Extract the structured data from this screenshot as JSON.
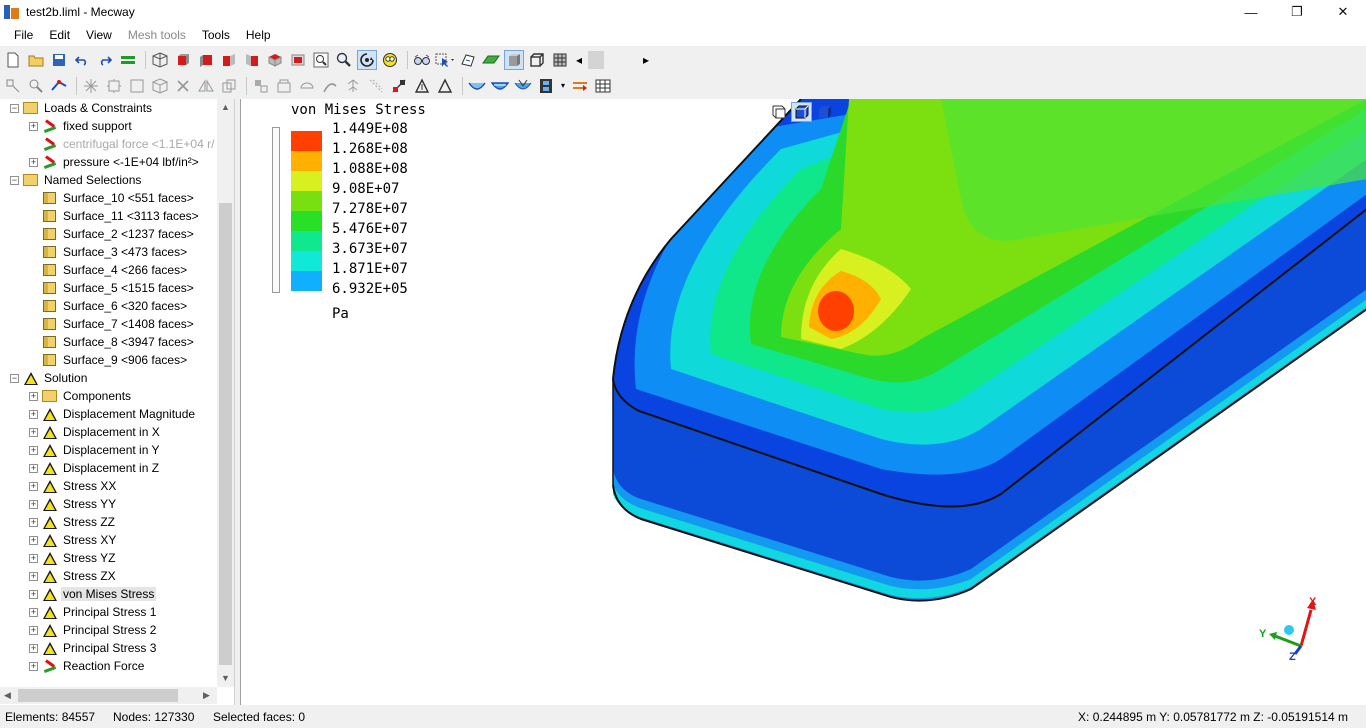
{
  "window": {
    "title": "test2b.liml - Mecway",
    "controls": {
      "minimize": "—",
      "maximize": "❐",
      "close": "✕"
    }
  },
  "menu": {
    "items": [
      "File",
      "Edit",
      "View",
      "Mesh tools",
      "Tools",
      "Help"
    ],
    "disabled": [
      "Mesh tools"
    ]
  },
  "toolbar1": {
    "icons": [
      "new-file-icon",
      "open-folder-icon",
      "save-icon",
      "undo-icon",
      "redo-icon",
      "equal-icon",
      "wireframe-cube-icon",
      "front-view-icon",
      "back-view-icon",
      "left-view-icon",
      "right-view-icon",
      "top-view-icon",
      "bottom-view-icon",
      "zoom-box-icon",
      "zoom-icon",
      "rotate-icon",
      "pan-icon",
      "glasses-icon",
      "cursor-icon",
      "select-box-icon",
      "surface-icon",
      "shaded-icon",
      "edges-icon",
      "hidden-lines-icon"
    ],
    "scroll_left": "◂",
    "scroll_right": "▸"
  },
  "toolbar2": {
    "icons": [
      "select-nodes-icon",
      "select-elements-icon",
      "select-faces-icon",
      "select-all-icon",
      "node-icon",
      "element-icon",
      "cube-outline-icon",
      "delete-icon",
      "mirror-icon",
      "copy-icon",
      "move-icon",
      "scale-icon",
      "refine-icon",
      "extrude-icon",
      "revolve-icon",
      "sweep-icon",
      "merge-icon",
      "split-icon",
      "tetra-icon",
      "triangle-icon",
      "bowl-icon",
      "bowl-fill-icon",
      "animate-icon",
      "film-icon",
      "deform-icon",
      "table-icon"
    ]
  },
  "tree": {
    "items": [
      {
        "level": 0,
        "expander": "−",
        "icon": "folder-load",
        "label": "Loads & Constraints"
      },
      {
        "level": 1,
        "expander": "+",
        "icon": "load",
        "label": "fixed support"
      },
      {
        "level": 1,
        "expander": "",
        "icon": "load",
        "label": "centrifugal force <1.1E+04 r/",
        "disabled": true
      },
      {
        "level": 1,
        "expander": "+",
        "icon": "load",
        "label": "pressure <-1E+04 lbf/in²>"
      },
      {
        "level": 0,
        "expander": "−",
        "icon": "folder",
        "label": "Named Selections"
      },
      {
        "level": 1,
        "expander": "",
        "icon": "cube",
        "label": "Surface_10 <551 faces>"
      },
      {
        "level": 1,
        "expander": "",
        "icon": "cube",
        "label": "Surface_11 <3113 faces>"
      },
      {
        "level": 1,
        "expander": "",
        "icon": "cube",
        "label": "Surface_2 <1237 faces>"
      },
      {
        "level": 1,
        "expander": "",
        "icon": "cube",
        "label": "Surface_3 <473 faces>"
      },
      {
        "level": 1,
        "expander": "",
        "icon": "cube",
        "label": "Surface_4 <266 faces>"
      },
      {
        "level": 1,
        "expander": "",
        "icon": "cube",
        "label": "Surface_5 <1515 faces>"
      },
      {
        "level": 1,
        "expander": "",
        "icon": "cube",
        "label": "Surface_6 <320 faces>"
      },
      {
        "level": 1,
        "expander": "",
        "icon": "cube",
        "label": "Surface_7 <1408 faces>"
      },
      {
        "level": 1,
        "expander": "",
        "icon": "cube",
        "label": "Surface_8 <3947 faces>"
      },
      {
        "level": 1,
        "expander": "",
        "icon": "cube",
        "label": "Surface_9 <906 faces>"
      },
      {
        "level": 0,
        "expander": "−",
        "icon": "triangle",
        "label": "Solution"
      },
      {
        "level": 1,
        "expander": "+",
        "icon": "folder",
        "label": "Components"
      },
      {
        "level": 1,
        "expander": "+",
        "icon": "triangle",
        "label": "Displacement Magnitude"
      },
      {
        "level": 1,
        "expander": "+",
        "icon": "triangle",
        "label": "Displacement in X"
      },
      {
        "level": 1,
        "expander": "+",
        "icon": "triangle",
        "label": "Displacement in Y"
      },
      {
        "level": 1,
        "expander": "+",
        "icon": "triangle",
        "label": "Displacement in Z"
      },
      {
        "level": 1,
        "expander": "+",
        "icon": "triangle",
        "label": "Stress XX"
      },
      {
        "level": 1,
        "expander": "+",
        "icon": "triangle",
        "label": "Stress YY"
      },
      {
        "level": 1,
        "expander": "+",
        "icon": "triangle",
        "label": "Stress ZZ"
      },
      {
        "level": 1,
        "expander": "+",
        "icon": "triangle",
        "label": "Stress XY"
      },
      {
        "level": 1,
        "expander": "+",
        "icon": "triangle",
        "label": "Stress YZ"
      },
      {
        "level": 1,
        "expander": "+",
        "icon": "triangle",
        "label": "Stress ZX"
      },
      {
        "level": 1,
        "expander": "+",
        "icon": "triangle",
        "label": "von Mises Stress",
        "selected": true
      },
      {
        "level": 1,
        "expander": "+",
        "icon": "triangle",
        "label": "Principal Stress 1"
      },
      {
        "level": 1,
        "expander": "+",
        "icon": "triangle",
        "label": "Principal Stress 2"
      },
      {
        "level": 1,
        "expander": "+",
        "icon": "triangle",
        "label": "Principal Stress 3"
      },
      {
        "level": 1,
        "expander": "+",
        "icon": "reaction",
        "label": "Reaction Force"
      }
    ]
  },
  "legend": {
    "title": "von Mises Stress",
    "unit": "Pa",
    "entries": [
      {
        "value": "1.449E+08",
        "color": "#ff4000"
      },
      {
        "value": "1.268E+08",
        "color": "#ffb000"
      },
      {
        "value": "1.088E+08",
        "color": "#d8f020"
      },
      {
        "value": "9.08E+07",
        "color": "#78e010"
      },
      {
        "value": "7.278E+07",
        "color": "#28e028"
      },
      {
        "value": "5.476E+07",
        "color": "#10e890"
      },
      {
        "value": "3.673E+07",
        "color": "#10e8d8"
      },
      {
        "value": "1.871E+07",
        "color": "#10b0ff"
      },
      {
        "value": "6.932E+05",
        "color": "#0050ff"
      }
    ]
  },
  "view_buttons": [
    "wireframe-view-icon",
    "shaded-edges-view-icon",
    "solid-view-icon"
  ],
  "axes": {
    "x": "X",
    "y": "Y",
    "z": "Z"
  },
  "status": {
    "elements": "Elements: 84557",
    "nodes": "Nodes: 127330",
    "faces": "Selected faces: 0",
    "coords": "X: 0.244895 m Y: 0.05781772 m Z: -0.05191514 m"
  }
}
